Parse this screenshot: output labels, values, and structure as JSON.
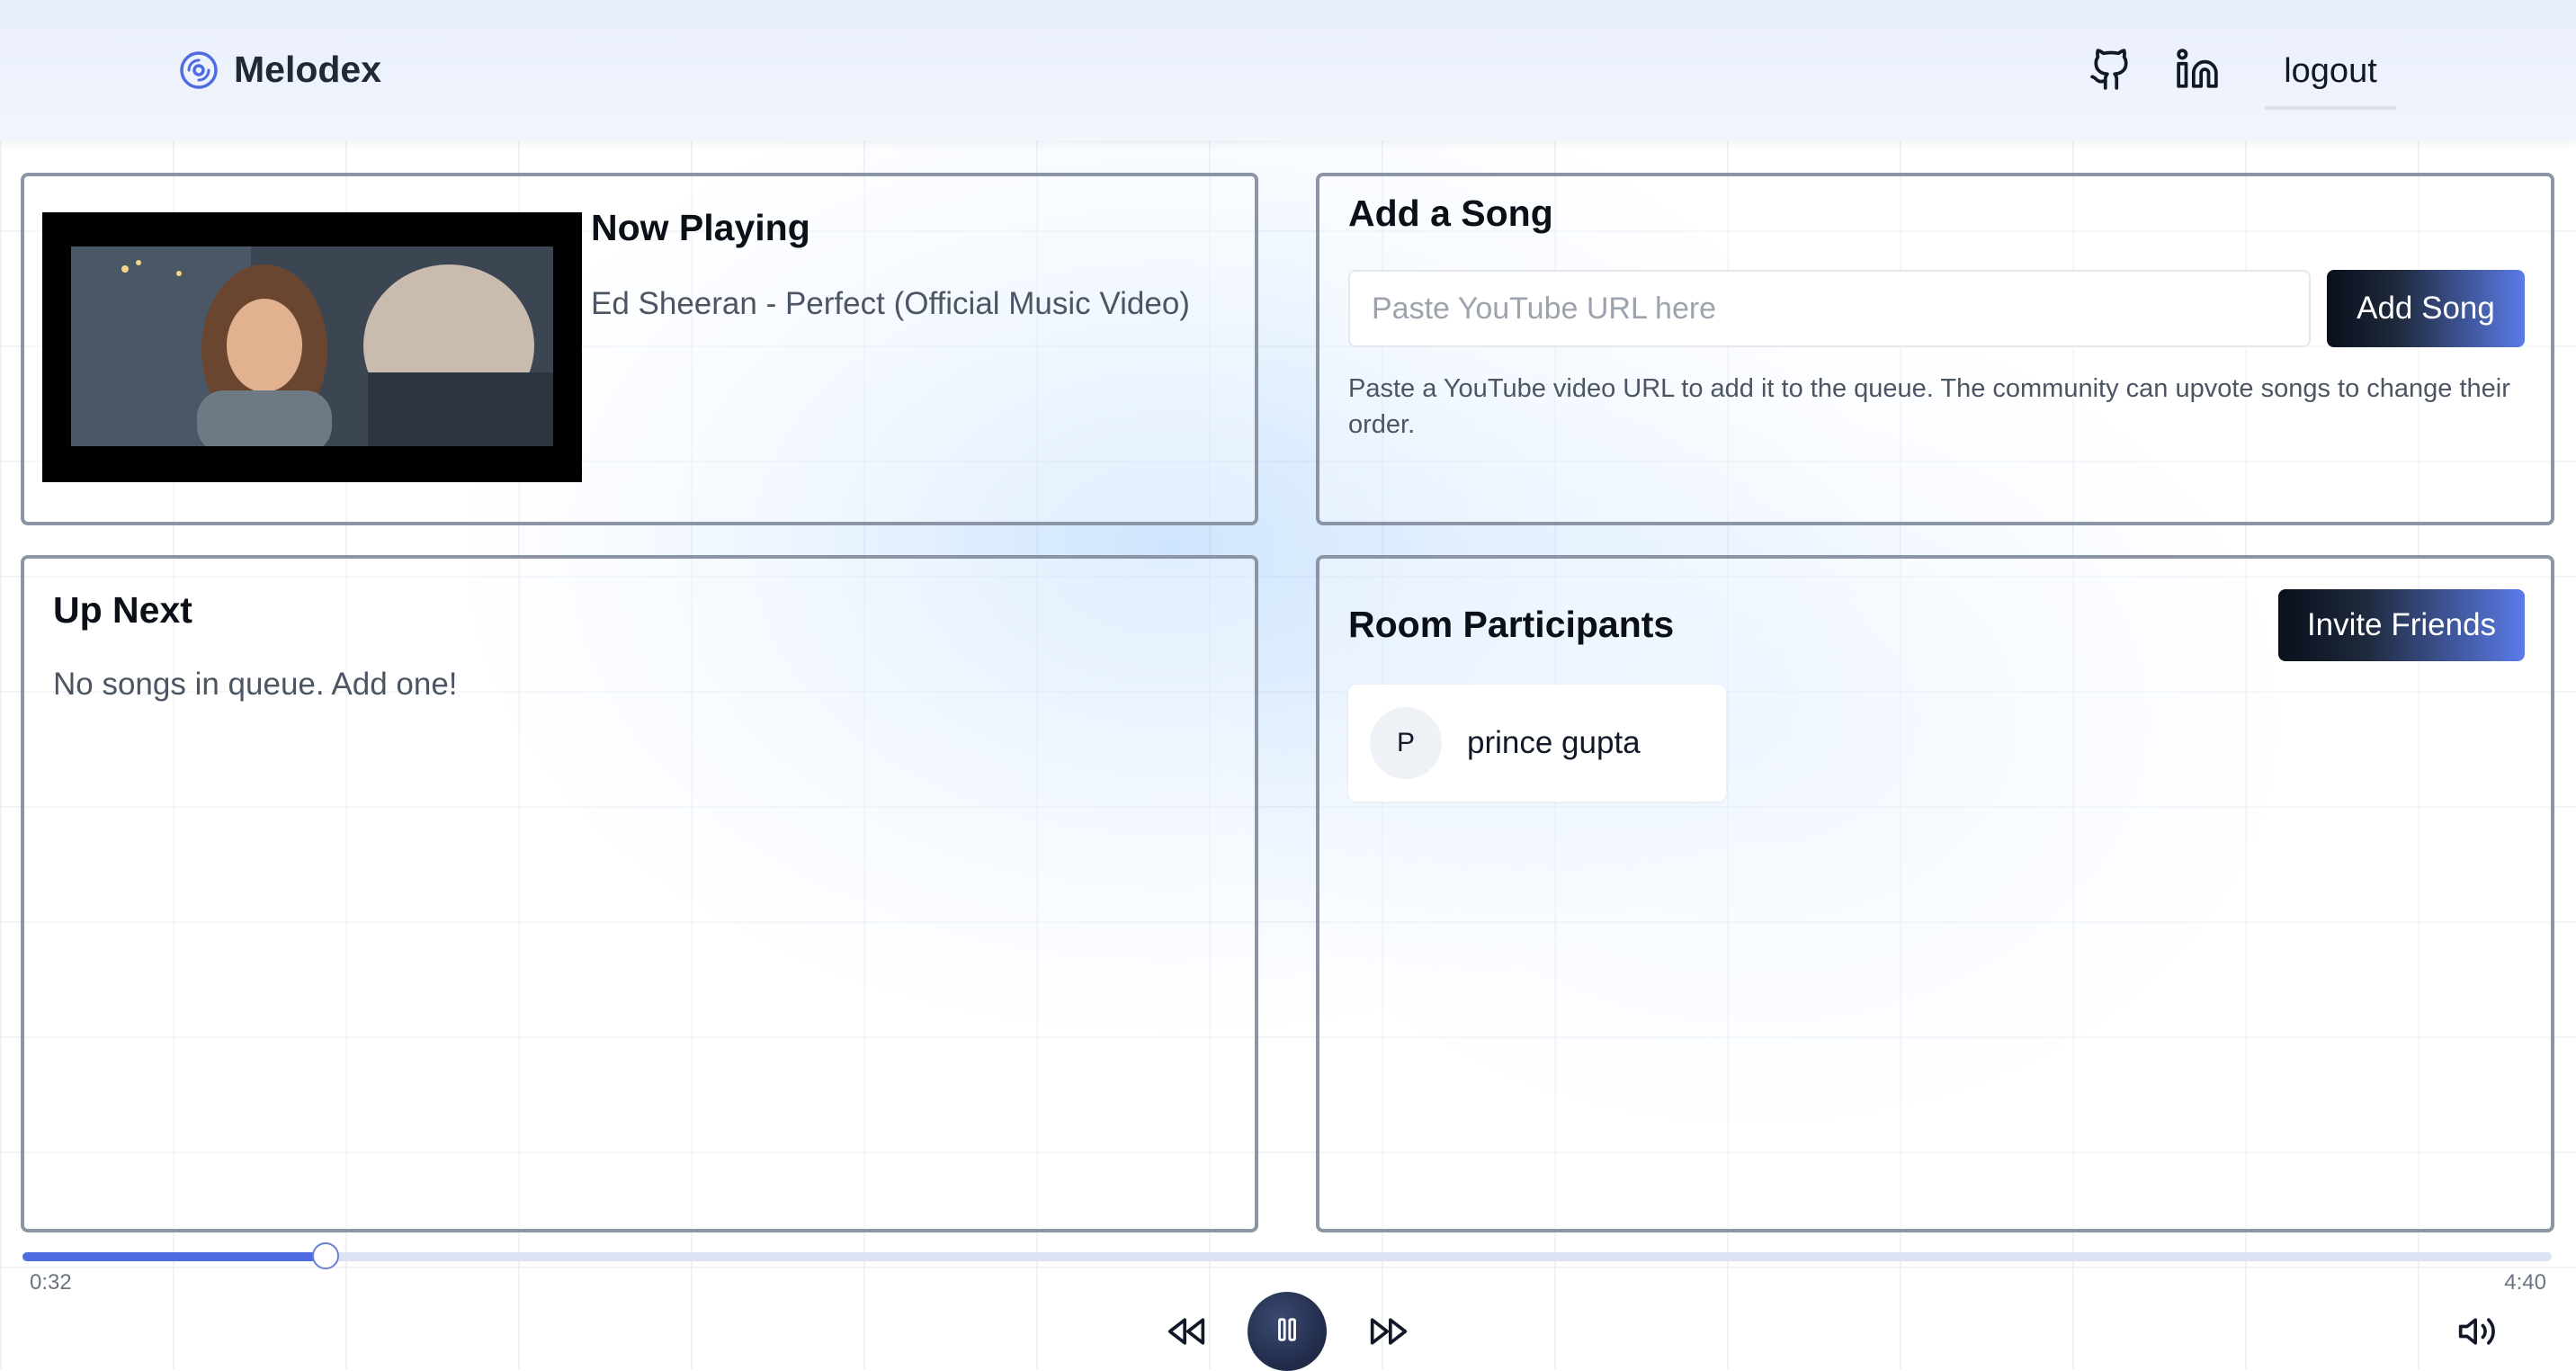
{
  "app": {
    "name": "Melodex",
    "logout_label": "logout",
    "icons": {
      "logo": "disc-icon",
      "github": "github-icon",
      "linkedin": "linkedin-icon"
    }
  },
  "now_playing": {
    "title": "Now Playing",
    "song": "Ed Sheeran - Perfect (Official Music Video)"
  },
  "add_song": {
    "title": "Add a Song",
    "input_placeholder": "Paste YouTube URL here",
    "input_value": "",
    "button_label": "Add Song",
    "help_text": "Paste a YouTube video URL to add it to the queue. The community can upvote songs to change their order."
  },
  "up_next": {
    "title": "Up Next",
    "empty_message": "No songs in queue. Add one!"
  },
  "participants": {
    "title": "Room Participants",
    "invite_label": "Invite Friends",
    "list": [
      {
        "initial": "P",
        "name": "prince gupta"
      }
    ]
  },
  "player": {
    "current_time": "0:32",
    "duration": "4:40",
    "progress_fraction": 0.12,
    "state": "playing",
    "icons": {
      "rewind": "rewind-icon",
      "pause": "pause-icon",
      "forward": "fast-forward-icon",
      "volume": "volume-icon"
    }
  },
  "colors": {
    "accent": "#4f6be2",
    "dark": "#0a0f1c",
    "border": "#8b95a5"
  }
}
